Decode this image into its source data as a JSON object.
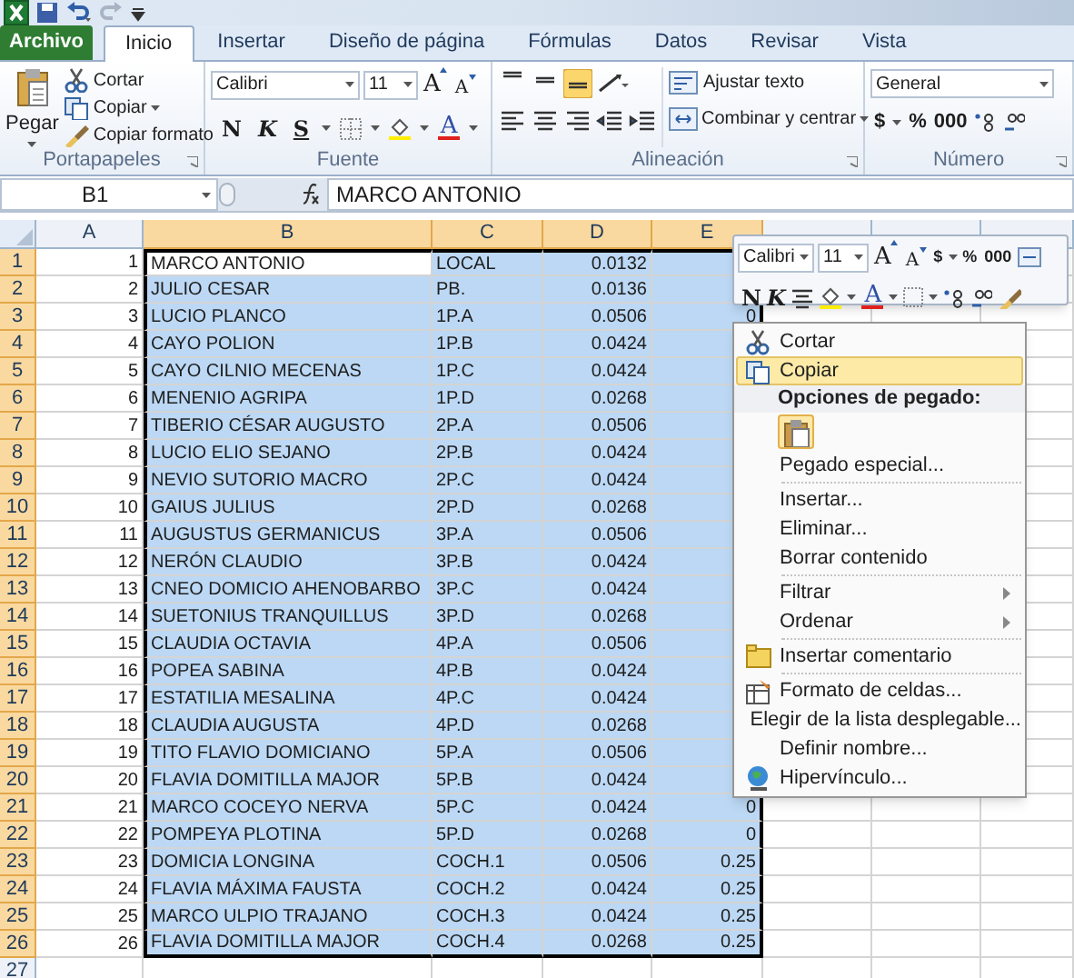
{
  "tabs": [
    {
      "label": "Archivo",
      "kind": "file",
      "selected": false
    },
    {
      "label": "Inicio",
      "kind": "tab",
      "selected": true
    },
    {
      "label": "Insertar",
      "kind": "tab",
      "selected": false
    },
    {
      "label": "Diseño de página",
      "kind": "tab",
      "selected": false
    },
    {
      "label": "Fórmulas",
      "kind": "tab",
      "selected": false
    },
    {
      "label": "Datos",
      "kind": "tab",
      "selected": false
    },
    {
      "label": "Revisar",
      "kind": "tab",
      "selected": false
    },
    {
      "label": "Vista",
      "kind": "tab",
      "selected": false
    }
  ],
  "ribbon": {
    "clipboard": {
      "label": "Portapapeles",
      "paste": "Pegar",
      "items": [
        "Cortar",
        "Copiar",
        "Copiar formato"
      ]
    },
    "font": {
      "label": "Fuente",
      "font_name": "Calibri",
      "font_size": "11",
      "size_buttons": [
        "A",
        "A"
      ],
      "style_buttons": [
        "N",
        "K",
        "S"
      ],
      "font_color": "A"
    },
    "alignment": {
      "label": "Alineación",
      "vertical": [
        {
          "selected": false
        },
        {
          "selected": false
        },
        {
          "selected": true
        }
      ],
      "wrap": "Ajustar texto",
      "merge": "Combinar y centrar"
    },
    "number": {
      "label": "Número",
      "format": "General",
      "buttons": [
        "$",
        "%",
        "000"
      ]
    }
  },
  "formula_bar": {
    "name_box": "B1",
    "formula": "MARCO ANTONIO"
  },
  "sheet": {
    "columns": [
      {
        "label": "A",
        "selected": false
      },
      {
        "label": "B",
        "selected": true
      },
      {
        "label": "C",
        "selected": true
      },
      {
        "label": "D",
        "selected": true
      },
      {
        "label": "E",
        "selected": true
      },
      {
        "selected": false
      },
      {
        "selected": false
      },
      {
        "selected": false
      }
    ],
    "rows": [
      {
        "header": "1",
        "selected": true,
        "cells": [
          "1",
          "MARCO ANTONIO",
          "LOCAL",
          "0.0132"
        ]
      },
      {
        "header": "2",
        "selected": true,
        "cells": [
          "2",
          "JULIO CESAR",
          "PB.",
          "0.0136"
        ]
      },
      {
        "header": "3",
        "selected": true,
        "cells": [
          "3",
          "LUCIO PLANCO",
          "1P.A",
          "0.0506",
          "0"
        ]
      },
      {
        "header": "4",
        "selected": true,
        "cells": [
          "4",
          "CAYO POLION",
          "1P.B",
          "0.0424"
        ]
      },
      {
        "header": "5",
        "selected": true,
        "cells": [
          "5",
          "CAYO CILNIO MECENAS",
          "1P.C",
          "0.0424"
        ]
      },
      {
        "header": "6",
        "selected": true,
        "cells": [
          "6",
          "MENENIO AGRIPA",
          "1P.D",
          "0.0268"
        ]
      },
      {
        "header": "7",
        "selected": true,
        "cells": [
          "7",
          "TIBERIO CÉSAR AUGUSTO",
          "2P.A",
          "0.0506"
        ]
      },
      {
        "header": "8",
        "selected": true,
        "cells": [
          "8",
          "LUCIO ELIO SEJANO",
          "2P.B",
          "0.0424"
        ]
      },
      {
        "header": "9",
        "selected": true,
        "cells": [
          "9",
          "NEVIO SUTORIO MACRO",
          "2P.C",
          "0.0424"
        ]
      },
      {
        "header": "10",
        "selected": true,
        "cells": [
          "10",
          "GAIUS JULIUS",
          "2P.D",
          "0.0268"
        ]
      },
      {
        "header": "11",
        "selected": true,
        "cells": [
          "11",
          "AUGUSTUS GERMANICUS",
          "3P.A",
          "0.0506"
        ]
      },
      {
        "header": "12",
        "selected": true,
        "cells": [
          "12",
          "NERÓN CLAUDIO",
          "3P.B",
          "0.0424"
        ]
      },
      {
        "header": "13",
        "selected": true,
        "cells": [
          "13",
          "CNEO DOMICIO AHENOBARBO",
          "3P.C",
          "0.0424"
        ]
      },
      {
        "header": "14",
        "selected": true,
        "cells": [
          "14",
          "SUETONIUS TRANQUILLUS",
          "3P.D",
          "0.0268"
        ]
      },
      {
        "header": "15",
        "selected": true,
        "cells": [
          "15",
          "CLAUDIA OCTAVIA",
          "4P.A",
          "0.0506"
        ]
      },
      {
        "header": "16",
        "selected": true,
        "cells": [
          "16",
          "POPEA SABINA",
          "4P.B",
          "0.0424"
        ]
      },
      {
        "header": "17",
        "selected": true,
        "cells": [
          "17",
          "ESTATILIA MESALINA",
          "4P.C",
          "0.0424"
        ]
      },
      {
        "header": "18",
        "selected": true,
        "cells": [
          "18",
          "CLAUDIA AUGUSTA",
          "4P.D",
          "0.0268"
        ]
      },
      {
        "header": "19",
        "selected": true,
        "cells": [
          "19",
          "TITO FLAVIO DOMICIANO",
          "5P.A",
          "0.0506"
        ]
      },
      {
        "header": "20",
        "selected": true,
        "cells": [
          "20",
          "FLAVIA DOMITILLA MAJOR",
          "5P.B",
          "0.0424"
        ]
      },
      {
        "header": "21",
        "selected": true,
        "cells": [
          "21",
          "MARCO COCEYO NERVA",
          "5P.C",
          "0.0424",
          "0"
        ]
      },
      {
        "header": "22",
        "selected": true,
        "cells": [
          "22",
          "POMPEYA PLOTINA",
          "5P.D",
          "0.0268",
          "0"
        ]
      },
      {
        "header": "23",
        "selected": true,
        "cells": [
          "23",
          "DOMICIA LONGINA",
          "COCH.1",
          "0.0506",
          "0.25"
        ]
      },
      {
        "header": "24",
        "selected": true,
        "cells": [
          "24",
          "FLAVIA MÁXIMA FAUSTA",
          "COCH.2",
          "0.0424",
          "0.25"
        ]
      },
      {
        "header": "25",
        "selected": true,
        "cells": [
          "25",
          "MARCO ULPIO TRAJANO",
          "COCH.3",
          "0.0424",
          "0.25"
        ]
      },
      {
        "header": "26",
        "selected": true,
        "cells": [
          "26",
          "FLAVIA DOMITILLA MAJOR",
          "COCH.4",
          "0.0268",
          "0.25"
        ]
      },
      {
        "header": "27",
        "selected": false,
        "cells": []
      }
    ]
  },
  "mini_toolbar": {
    "font_name": "Calibri",
    "font_size": "11",
    "size_buttons": [
      "A",
      "A"
    ],
    "buttons": [
      "$",
      "%",
      "000"
    ],
    "style_buttons": [
      "N",
      "K"
    ],
    "font_color": "A"
  },
  "context_menu": [
    {
      "kind": "item",
      "label": "Cortar",
      "selected": false
    },
    {
      "kind": "item",
      "label": "Copiar",
      "selected": true
    },
    {
      "kind": "header",
      "label": "Opciones de pegado:"
    },
    {
      "kind": "paste_options"
    },
    {
      "kind": "item",
      "label": "Pegado especial...",
      "selected": false
    },
    {
      "kind": "separator"
    },
    {
      "kind": "item",
      "label": "Insertar...",
      "selected": false
    },
    {
      "kind": "item",
      "label": "Eliminar...",
      "selected": false
    },
    {
      "kind": "item",
      "label": "Borrar contenido",
      "selected": false
    },
    {
      "kind": "separator"
    },
    {
      "kind": "submenu",
      "label": "Filtrar",
      "selected": false
    },
    {
      "kind": "submenu",
      "label": "Ordenar",
      "selected": false
    },
    {
      "kind": "separator"
    },
    {
      "kind": "item",
      "label": "Insertar comentario",
      "selected": false
    },
    {
      "kind": "separator"
    },
    {
      "kind": "item",
      "label": "Formato de celdas...",
      "selected": false
    },
    {
      "kind": "item",
      "label": "Elegir de la lista desplegable...",
      "selected": false
    },
    {
      "kind": "item",
      "label": "Definir nombre...",
      "selected": false
    },
    {
      "kind": "item",
      "label": "Hipervínculo...",
      "selected": false
    }
  ]
}
